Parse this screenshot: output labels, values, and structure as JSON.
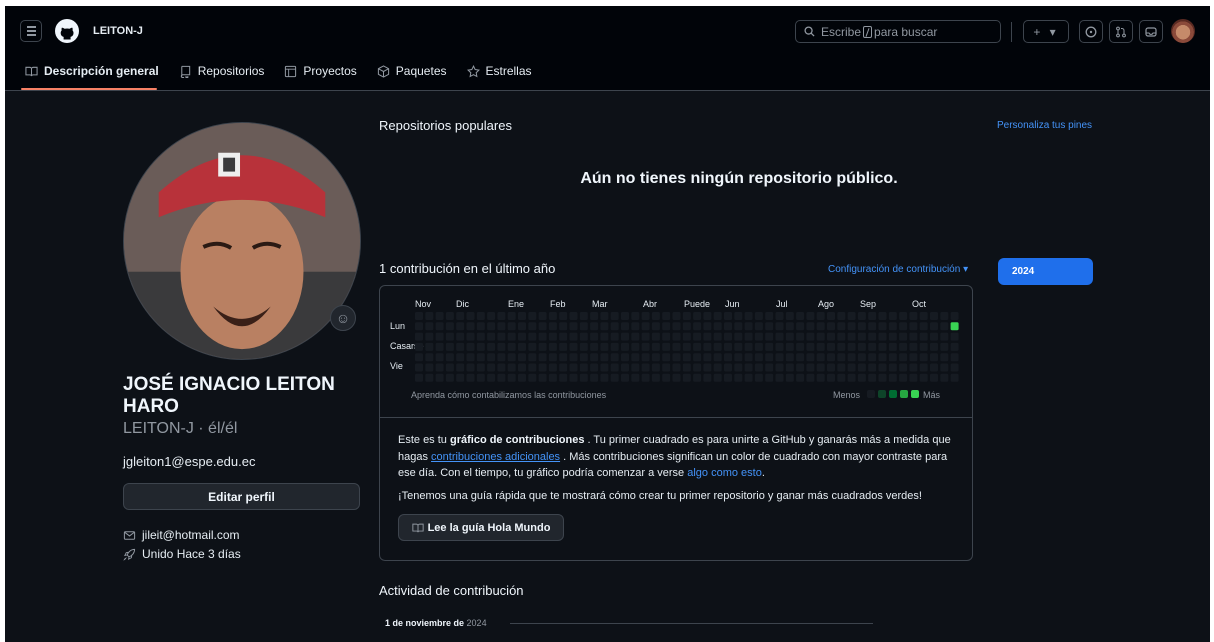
{
  "header": {
    "username": "LEITON-J",
    "search_placeholder_pre": "Escribe",
    "search_placeholder_post": "para buscar",
    "new_label": "+ ▾"
  },
  "tabs": [
    {
      "label": "Descripción general",
      "icon": "book-icon"
    },
    {
      "label": "Repositorios",
      "icon": "repo-icon"
    },
    {
      "label": "Proyectos",
      "icon": "table-icon"
    },
    {
      "label": "Paquetes",
      "icon": "package-icon"
    },
    {
      "label": "Estrellas",
      "icon": "star-icon"
    }
  ],
  "profile": {
    "fullname": "JOSÉ IGNACIO LEITON HARO",
    "handle": "LEITON-J · él/él",
    "bio": "jgleiton1@espe.edu.ec",
    "edit_label": "Editar perfil",
    "email": "jileit@hotmail.com",
    "joined": "Unido Hace 3 días"
  },
  "popular": {
    "title": "Repositorios populares",
    "customize": "Personaliza tus pines",
    "empty": "Aún no tienes ningún repositorio público."
  },
  "contributions": {
    "title": "1 contribución en el último año",
    "settings": "Configuración de contribución ▾",
    "year": "2024",
    "months": [
      "Nov",
      "Dic",
      "Ene",
      "Feb",
      "Mar",
      "Abr",
      "Puede",
      "Jun",
      "Jul",
      "Ago",
      "Sep",
      "Oct"
    ],
    "days": [
      "Lun",
      "Casarse",
      "Vie"
    ],
    "learn": "Aprenda cómo contabilizamos las contribuciones",
    "less": "Menos",
    "more": "Más",
    "weeks": 53,
    "active_cell": {
      "week": 52,
      "day": 1
    },
    "colors": {
      "empty": "#161b22",
      "level1": "#0e4429",
      "level2": "#006d32",
      "level3": "#26a641",
      "level4": "#39d353"
    }
  },
  "explainer": {
    "p1_a": "Este es tu ",
    "p1_b": "gráfico de contribuciones",
    "p1_c": " . Tu primer cuadrado es para unirte a GitHub y ganarás más a medida que hagas ",
    "p1_link": "contribuciones adicionales",
    "p1_d": " . Más contribuciones significan un color de cuadrado con mayor contraste para ese día. Con el tiempo, tu gráfico podría comenzar a verse ",
    "p1_link2": "algo como esto",
    "p1_e": ".",
    "p2": "¡Tenemos una guía rápida que te mostrará cómo crear tu primer repositorio y ganar más cuadrados verdes!",
    "guide_label": "Lee la guía Hola Mundo"
  },
  "activity": {
    "title": "Actividad de contribución",
    "date_prefix": "1 de noviembre de",
    "date_year": "2024"
  }
}
